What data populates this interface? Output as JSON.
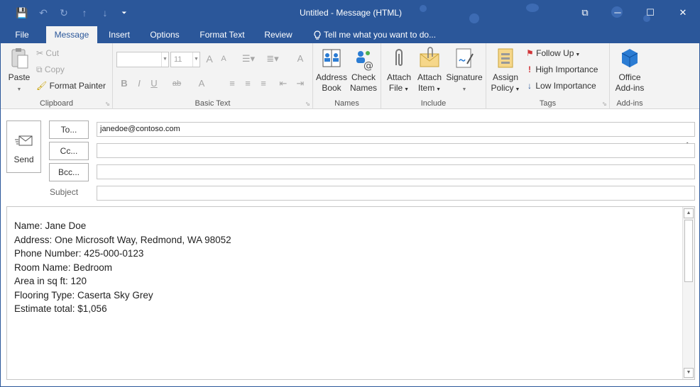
{
  "window": {
    "title": "Untitled  -  Message (HTML)",
    "controls": {
      "restore": "⧉",
      "minimize": "─",
      "maximize": "☐",
      "close": "✕"
    }
  },
  "qat": {
    "save": "💾",
    "undo": "↶",
    "redo": "↻",
    "up": "↑",
    "down": "↓",
    "customize": "⏷"
  },
  "tabs": [
    "File",
    "Message",
    "Insert",
    "Options",
    "Format Text",
    "Review"
  ],
  "tell_me": "Tell me what you want to do...",
  "ribbon": {
    "clipboard": {
      "label": "Clipboard",
      "paste": "Paste",
      "cut": "Cut",
      "copy": "Copy",
      "format_painter": "Format Painter"
    },
    "basic_text": {
      "label": "Basic Text",
      "font_name": "",
      "font_size": "11",
      "bold": "B",
      "italic": "I",
      "underline": "U",
      "grow": "A",
      "shrink": "A",
      "clear": "A",
      "highlight": "ab",
      "color": "A"
    },
    "names": {
      "label": "Names",
      "address_book_1": "Address",
      "address_book_2": "Book",
      "check_names_1": "Check",
      "check_names_2": "Names"
    },
    "include": {
      "label": "Include",
      "attach_file_1": "Attach",
      "attach_file_2": "File",
      "attach_item_1": "Attach",
      "attach_item_2": "Item",
      "signature": "Signature"
    },
    "tags": {
      "label": "Tags",
      "assign_policy_1": "Assign",
      "assign_policy_2": "Policy",
      "follow_up": "Follow Up",
      "high_importance": "High Importance",
      "low_importance": "Low Importance"
    },
    "addins": {
      "label": "Add-ins",
      "office_addins_1": "Office",
      "office_addins_2": "Add-ins"
    }
  },
  "compose": {
    "send": "Send",
    "to_label": "To...",
    "cc_label": "Cc...",
    "bcc_label": "Bcc...",
    "subject_label": "Subject",
    "to_value": "janedoe@contoso.com",
    "cc_value": "",
    "bcc_value": "",
    "subject_value": ""
  },
  "body_lines": [
    "Name: Jane Doe",
    "Address: One Microsoft Way, Redmond, WA 98052",
    "Phone Number: 425-000-0123",
    "Room Name: Bedroom",
    "Area in sq ft: 120",
    "Flooring Type: Caserta Sky Grey",
    "Estimate total: $1,056"
  ],
  "colors": {
    "accent": "#2b579a",
    "ribbon_bg": "#f3f3f3",
    "high_importance": "#d13438",
    "follow_up_flag": "#d13438",
    "low_importance": "#2b579a"
  }
}
